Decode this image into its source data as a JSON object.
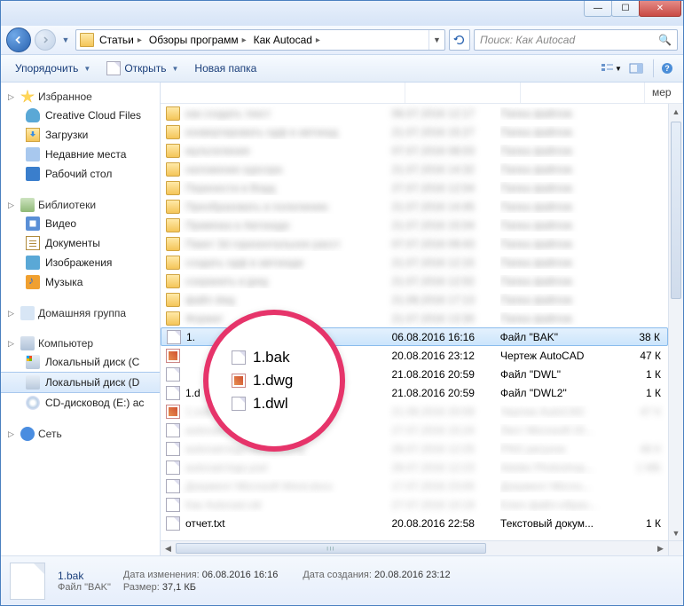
{
  "titlebar": {
    "min": "—",
    "max": "☐",
    "close": "✕"
  },
  "nav": {
    "crumbs": [
      "Статьи",
      "Обзоры программ",
      "Как Autocad"
    ],
    "search_placeholder": "Поиск: Как Autocad"
  },
  "toolbar": {
    "organize": "Упорядочить",
    "open": "Открыть",
    "new_folder": "Новая папка"
  },
  "sidebar": {
    "favorites": {
      "label": "Избранное",
      "items": [
        "Creative Cloud Files",
        "Загрузки",
        "Недавние места",
        "Рабочий стол"
      ]
    },
    "libraries": {
      "label": "Библиотеки",
      "items": [
        "Видео",
        "Документы",
        "Изображения",
        "Музыка"
      ]
    },
    "homegroup": {
      "label": "Домашняя группа"
    },
    "computer": {
      "label": "Компьютер",
      "items": [
        "Локальный диск (C",
        "Локальный диск (D",
        "CD-дисковод (E:) ac"
      ]
    },
    "network": {
      "label": "Сеть"
    }
  },
  "columns": {
    "size_hdr": "мер"
  },
  "files": {
    "bak": {
      "name": "1.",
      "date": "06.08.2016 16:16",
      "type": "Файл \"BAK\"",
      "size": "38 К"
    },
    "dwg": {
      "name": "",
      "date": "20.08.2016 23:12",
      "type": "Чертеж AutoCAD",
      "size": "47 К"
    },
    "dwl": {
      "name": "",
      "date": "21.08.2016 20:59",
      "type": "Файл \"DWL\"",
      "size": "1 К"
    },
    "dwl2": {
      "name": "1.d",
      "date": "21.08.2016 20:59",
      "type": "Файл \"DWL2\"",
      "size": "1 К"
    },
    "txt": {
      "name": "отчет.txt",
      "date": "20.08.2016 22:58",
      "type": "Текстовый докум...",
      "size": "1 К"
    }
  },
  "blurred": [
    {
      "name": "как создать текст",
      "date": "06.07.2016 12:17",
      "type": "Папка файлов",
      "size": "",
      "ic": "folder"
    },
    {
      "name": "конвертировать пдф в автокад",
      "date": "21.07.2016 15:27",
      "type": "Папка файлов",
      "size": "",
      "ic": "folder"
    },
    {
      "name": "мультилиния",
      "date": "07.07.2016 08:03",
      "type": "Папка файлов",
      "size": "",
      "ic": "folder"
    },
    {
      "name": "наложение курсора",
      "date": "21.07.2016 14:32",
      "type": "Папка файлов",
      "size": "",
      "ic": "folder"
    },
    {
      "name": "Перенести в Ворд",
      "date": "27.07.2016 12:04",
      "type": "Папка файлов",
      "size": "",
      "ic": "folder"
    },
    {
      "name": "Преобразовать в полилинию",
      "date": "21.07.2016 14:45",
      "type": "Папка файлов",
      "size": "",
      "ic": "folder"
    },
    {
      "name": "Привязка в Автокаде",
      "date": "21.07.2016 15:04",
      "type": "Папка файлов",
      "size": "",
      "ic": "folder"
    },
    {
      "name": "Пакет 3d горизонтальное расст",
      "date": "07.07.2016 09:43",
      "type": "Папка файлов",
      "size": "",
      "ic": "folder"
    },
    {
      "name": "создать пдф в автокаде",
      "date": "21.07.2016 12:15",
      "type": "Папка файлов",
      "size": "",
      "ic": "folder"
    },
    {
      "name": "сохранить в jpeg",
      "date": "21.07.2016 12:02",
      "type": "Папка файлов",
      "size": "",
      "ic": "folder"
    },
    {
      "name": "файл dwg",
      "date": "21.08.2016 17:13",
      "type": "Папка файлов",
      "size": "",
      "ic": "folder"
    },
    {
      "name": "Формат",
      "date": "21.07.2016 13:30",
      "type": "Папка файлов",
      "size": "",
      "ic": "folder"
    }
  ],
  "blurred2": [
    {
      "name": "1.sv$",
      "date": "21.08.2016 20:59",
      "type": "Чертеж AutoCAD",
      "size": "47 К",
      "ic": "dwg"
    },
    {
      "name": "autocad.xlsx",
      "date": "27.07.2016 15:24",
      "type": "Лист Microsoft Of...",
      "size": "",
      "ic": "file"
    },
    {
      "name": "autocad-logo-иконка.png",
      "date": "28.07.2016 12:25",
      "type": "PNG рисунок",
      "size": "48 К",
      "ic": "file"
    },
    {
      "name": "autocad-logo.psd",
      "date": "28.07.2016 12:23",
      "type": "Adobe Photoshop...",
      "size": "1 МБ",
      "ic": "file"
    },
    {
      "name": "Документ Microsoft Word.docx",
      "date": "17.07.2016 23:00",
      "type": "Документ Micros...",
      "size": "",
      "ic": "file"
    },
    {
      "name": "Как Autocad.cdr",
      "date": "27.07.2016 10:19",
      "type": "Ключ файл-образ...",
      "size": "",
      "ic": "file"
    }
  ],
  "callout": {
    "r1": "1.bak",
    "r2": "1.dwg",
    "r3": "1.dwl"
  },
  "details": {
    "filename": "1.bak",
    "filetype": "Файл \"BAK\"",
    "mod_lbl": "Дата изменения:",
    "mod_val": "06.08.2016 16:16",
    "sz_lbl": "Размер:",
    "sz_val": "37,1 КБ",
    "cr_lbl": "Дата создания:",
    "cr_val": "20.08.2016 23:12"
  }
}
